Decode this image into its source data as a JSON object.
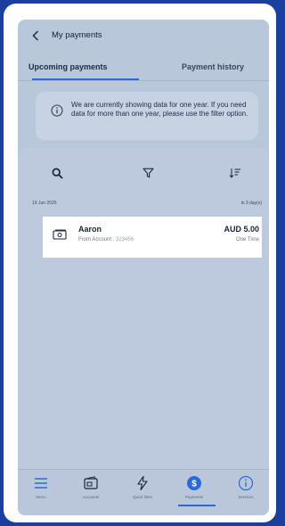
{
  "header": {
    "title": "My payments",
    "tabs": [
      {
        "label": "Upcoming payments",
        "active": true
      },
      {
        "label": "Payment history",
        "active": false
      }
    ]
  },
  "notice": {
    "text": "We are currently showing data for one year. If you need data for more than one year, please use the filter option."
  },
  "toolbar": {
    "icons": [
      "search-icon",
      "filter-icon",
      "sort-icon"
    ]
  },
  "group": {
    "date": "19 Jun 2026",
    "relative": "in 3 day(s)"
  },
  "payment": {
    "payee": "Aaron",
    "from_label": "From Account :",
    "from_number": "323456",
    "amount": "AUD 5.00",
    "frequency": "One Time"
  },
  "nav": {
    "items": [
      {
        "label": "Menu",
        "icon": "menu-icon"
      },
      {
        "label": "Accounts",
        "icon": "accounts-icon"
      },
      {
        "label": "Quick links",
        "icon": "lightning-icon"
      },
      {
        "label": "Payments",
        "icon": "dollar-icon",
        "active": true
      },
      {
        "label": "Services",
        "icon": "info-icon"
      }
    ]
  },
  "colors": {
    "accent": "#2a6ad8",
    "outer_border": "#1a3f9e"
  }
}
